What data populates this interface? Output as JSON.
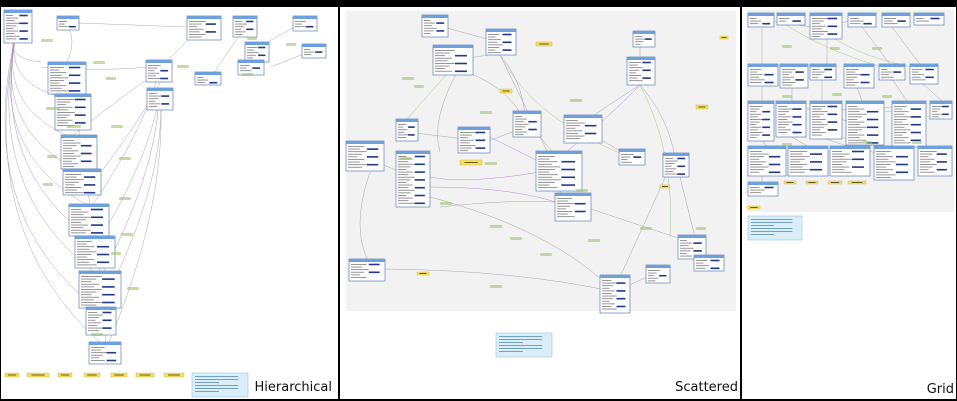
{
  "panels": [
    {
      "id": "hierarchical",
      "label": "Hierarchical"
    },
    {
      "id": "scattered",
      "label": "Scattered"
    },
    {
      "id": "grid",
      "label": "Grid"
    }
  ],
  "colors": {
    "table_header": "#6fa0de",
    "table_border": "#5d7fb5",
    "table_body": "#ffffff",
    "bar": "#1f3b8a",
    "edge_grey": "#9a9a9a",
    "edge_purple": "#b07ad6",
    "edge_green": "#9fc36b",
    "sticky": "#f3e064",
    "note_bg": "#d9eef9",
    "canvas_bg": "#f2f2f2"
  }
}
